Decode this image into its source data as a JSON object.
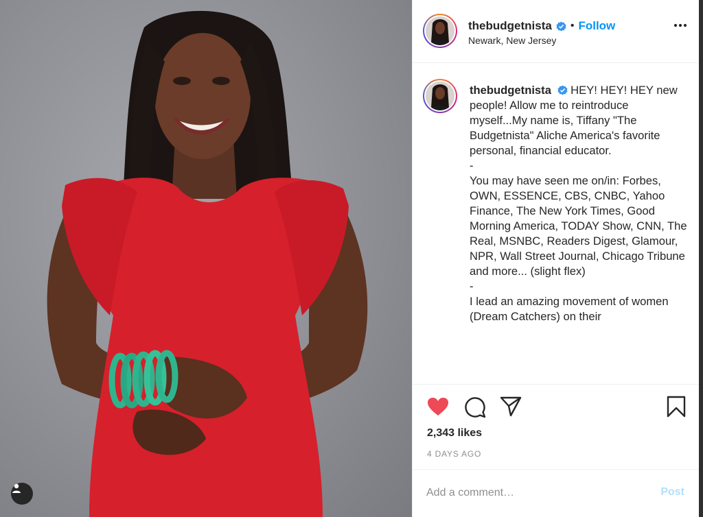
{
  "post": {
    "username": "thebudgetnista",
    "follow_label": "Follow",
    "separator": "•",
    "location": "Newark, New Jersey",
    "caption_paragraphs": [
      "HEY! HEY! HEY new people! Allow me to reintroduce myself...My name is, Tiffany \"The Budgetnista\" Aliche America's favorite personal, financial educator.",
      "-",
      " ",
      "You may have seen me on/in: Forbes, OWN, ESSENCE, CBS, CNBC, Yahoo Finance, The New York Times, Good Morning America, TODAY Show, CNN, The Real, MSNBC, Readers Digest, Glamour, NPR, Wall Street Journal, Chicago Tribune and more... (slight flex)",
      "-",
      " ",
      "I lead an amazing movement of women (Dream Catchers) on their"
    ],
    "likes": "2,343 likes",
    "age": "4 DAYS AGO",
    "comment_placeholder": "Add a comment…",
    "post_label": "Post"
  },
  "colors": {
    "like_red": "#ed4956",
    "link_blue": "#0095f6",
    "post_disabled": "#b2dffc",
    "dress_red": "#d6202c",
    "bangle_green": "#2fb58e"
  },
  "icons": {
    "like": "heart-icon",
    "comment": "comment-icon",
    "share": "send-icon",
    "save": "bookmark-icon",
    "more": "more-horizontal-icon",
    "verified": "verified-badge-icon",
    "tag": "user-tag-icon"
  }
}
